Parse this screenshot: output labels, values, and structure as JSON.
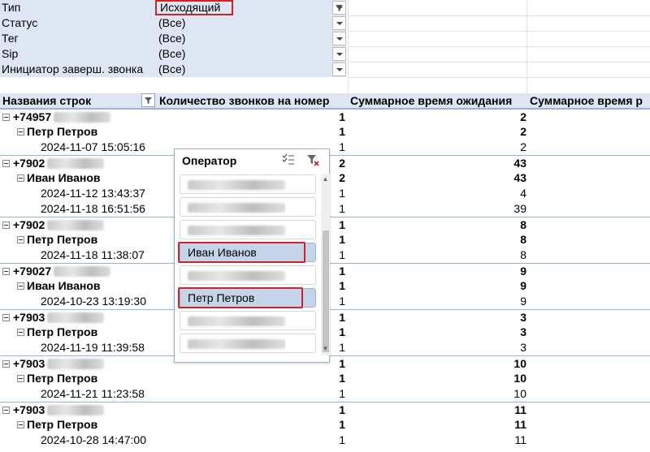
{
  "filters": [
    {
      "label": "Тип",
      "value": "Исходящий",
      "filtered": true
    },
    {
      "label": "Статус",
      "value": "(Все)",
      "filtered": false
    },
    {
      "label": "Тег",
      "value": "(Все)",
      "filtered": false
    },
    {
      "label": "Sip",
      "value": "(Все)",
      "filtered": false
    },
    {
      "label": "Инициатор заверш. звонка",
      "value": "(Все)",
      "filtered": false
    }
  ],
  "pivot": {
    "headers": [
      "Названия строк",
      "Количество звонков на номер",
      "Суммарное время ожидания",
      "Суммарное время р"
    ],
    "rows": [
      {
        "level": 0,
        "label": "+74957",
        "count": "1",
        "wait": "2"
      },
      {
        "level": 1,
        "label": "Петр Петров",
        "count": "1",
        "wait": "2"
      },
      {
        "level": 2,
        "label": "2024-11-07 15:05:16",
        "count": "1",
        "wait": "2"
      },
      {
        "level": 0,
        "label": "+7902",
        "count": "2",
        "wait": "43"
      },
      {
        "level": 1,
        "label": "Иван Иванов",
        "count": "2",
        "wait": "43"
      },
      {
        "level": 2,
        "label": "2024-11-12 13:43:37",
        "count": "1",
        "wait": "4"
      },
      {
        "level": 2,
        "label": "2024-11-18 16:51:56",
        "count": "1",
        "wait": "39"
      },
      {
        "level": 0,
        "label": "+7902",
        "count": "1",
        "wait": "8"
      },
      {
        "level": 1,
        "label": "Петр Петров",
        "count": "1",
        "wait": "8"
      },
      {
        "level": 2,
        "label": "2024-11-18 11:38:07",
        "count": "1",
        "wait": "8"
      },
      {
        "level": 0,
        "label": "+79027",
        "count": "1",
        "wait": "9"
      },
      {
        "level": 1,
        "label": "Иван Иванов",
        "count": "1",
        "wait": "9"
      },
      {
        "level": 2,
        "label": "2024-10-23 13:19:30",
        "count": "1",
        "wait": "9"
      },
      {
        "level": 0,
        "label": "+7903",
        "count": "1",
        "wait": "3"
      },
      {
        "level": 1,
        "label": "Петр Петров",
        "count": "1",
        "wait": "3"
      },
      {
        "level": 2,
        "label": "2024-11-19 11:39:58",
        "count": "1",
        "wait": "3"
      },
      {
        "level": 0,
        "label": "+7903",
        "count": "1",
        "wait": "10"
      },
      {
        "level": 1,
        "label": "Петр Петров",
        "count": "1",
        "wait": "10"
      },
      {
        "level": 2,
        "label": "2024-11-21 11:23:58",
        "count": "1",
        "wait": "10"
      },
      {
        "level": 0,
        "label": "+7903",
        "count": "1",
        "wait": "11"
      },
      {
        "level": 1,
        "label": "Петр Петров",
        "count": "1",
        "wait": "11"
      },
      {
        "level": 2,
        "label": "2024-10-28 14:47:00",
        "count": "1",
        "wait": "11"
      }
    ]
  },
  "slicer": {
    "title": "Оператор",
    "items": [
      {
        "label": "",
        "selected": false,
        "blurred": true
      },
      {
        "label": "",
        "selected": false,
        "blurred": true
      },
      {
        "label": "",
        "selected": false,
        "blurred": true
      },
      {
        "label": "Иван Иванов",
        "selected": true,
        "blurred": false
      },
      {
        "label": "",
        "selected": false,
        "blurred": true
      },
      {
        "label": "Петр Петров",
        "selected": true,
        "blurred": false
      },
      {
        "label": "",
        "selected": false,
        "blurred": true
      },
      {
        "label": "",
        "selected": false,
        "blurred": true
      }
    ]
  },
  "colors": {
    "header_bg": "#dde6f2",
    "selected_item": "#c5d5e9",
    "highlight": "#d0202a"
  }
}
